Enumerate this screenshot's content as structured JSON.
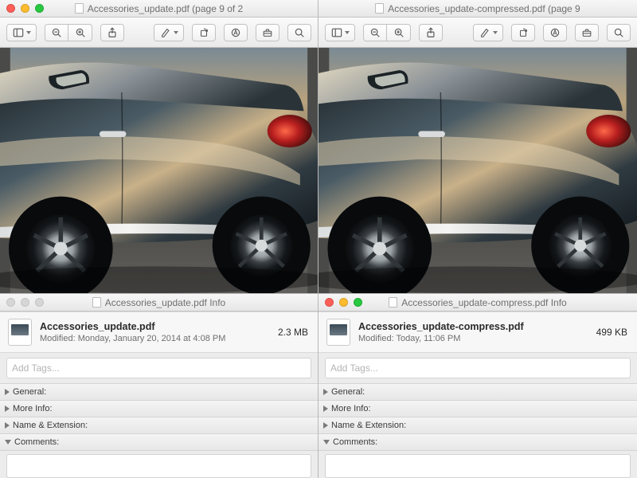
{
  "left": {
    "preview_title": "Accessories_update.pdf (page 9 of 2",
    "info_title": "Accessories_update.pdf Info",
    "file_name": "Accessories_update.pdf",
    "modified_label": "Modified: Monday, January 20, 2014 at 4:08 PM",
    "size": "2.3 MB",
    "tags_placeholder": "Add Tags...",
    "sections": {
      "general": "General:",
      "more": "More Info:",
      "name_ext": "Name & Extension:",
      "comments": "Comments:"
    }
  },
  "right": {
    "preview_title": "Accessories_update-compressed.pdf (page 9",
    "info_title": "Accessories_update-compress.pdf Info",
    "file_name": "Accessories_update-compress.pdf",
    "modified_label": "Modified: Today, 11:06 PM",
    "size": "499 KB",
    "tags_placeholder": "Add Tags...",
    "sections": {
      "general": "General:",
      "more": "More Info:",
      "name_ext": "Name & Extension:",
      "comments": "Comments:"
    }
  },
  "icons": {
    "sidebar": "sidebar-toggle-icon",
    "zoom_out": "zoom-out-icon",
    "zoom_in": "zoom-in-icon",
    "share": "share-icon",
    "highlight": "highlighter-icon",
    "rotate": "rotate-icon",
    "markup": "markup-toolbox-icon",
    "toolbox": "toolbox-icon",
    "search": "search-icon"
  }
}
